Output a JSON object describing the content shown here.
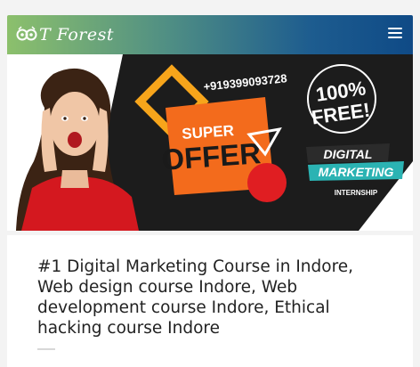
{
  "header": {
    "logo_text": "T Forest",
    "menu_icon": "hamburger-menu-icon",
    "gradient_colors": [
      "#8cc06c",
      "#1d5c8f",
      "#0f4a86"
    ]
  },
  "banner": {
    "phone": "+919399093728",
    "offer_line1": "SUPER",
    "offer_line2": "OFFER",
    "free_line1": "100%",
    "free_line2": "FREE!",
    "tag_line1": "DIGITAL",
    "tag_line2": "MARKETING",
    "tag_line3": "INTERNSHIP",
    "accent_orange": "#f36b1c",
    "accent_red": "#e01e22",
    "accent_teal": "#2bb3b3"
  },
  "post": {
    "title": "#1 Digital Marketing Course in Indore, Web design course Indore, Web development course Indore, Ethical hacking course Indore"
  }
}
